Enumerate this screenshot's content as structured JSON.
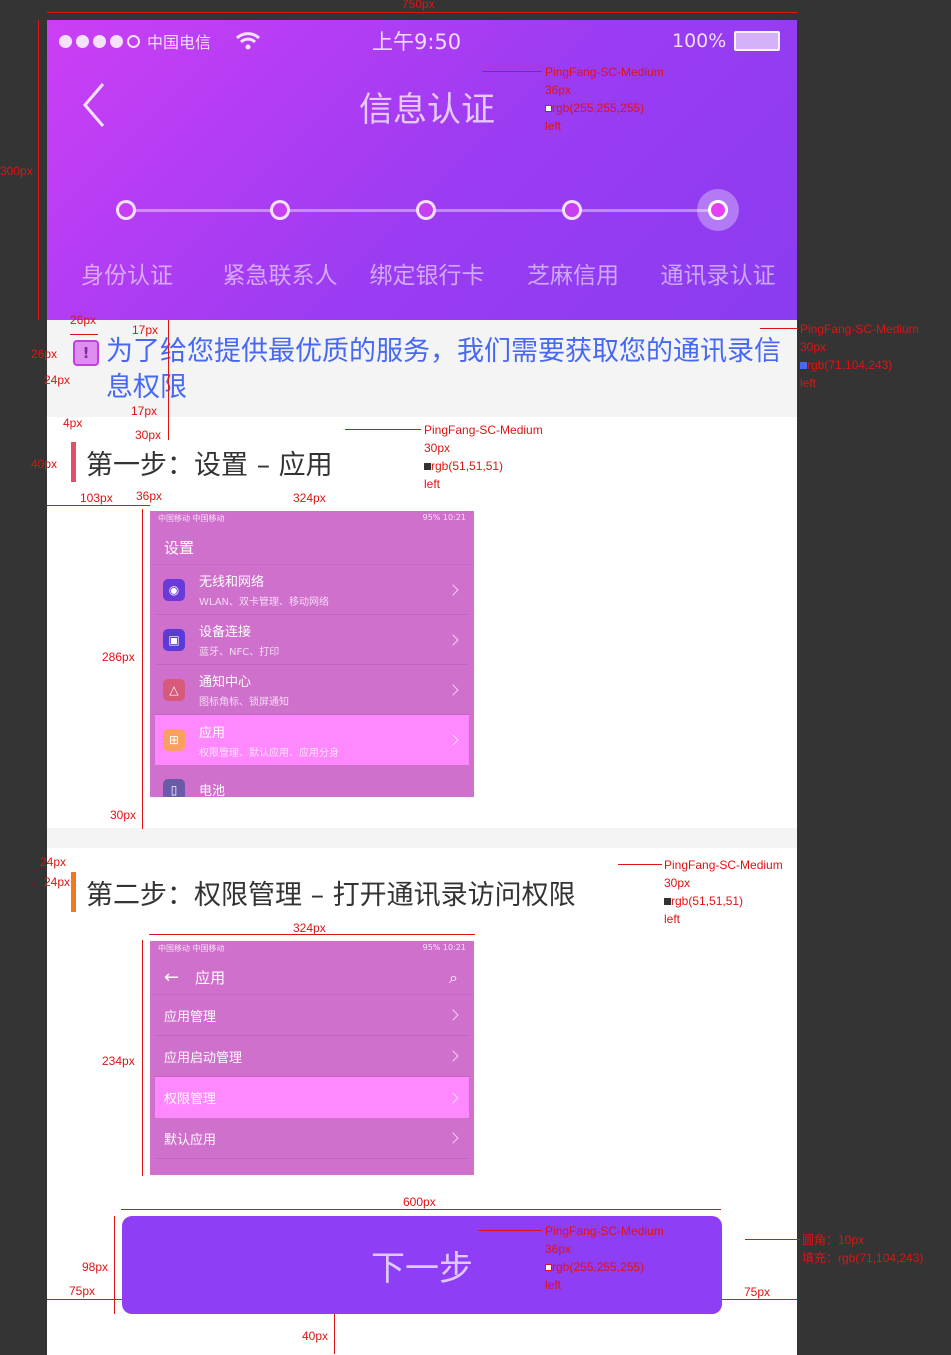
{
  "canvas_label": "750px",
  "status": {
    "carrier": "中国电信",
    "time": "上午9:50",
    "battery": "100%"
  },
  "nav": {
    "title": "信息认证"
  },
  "steps": [
    "身份认证",
    "紧急联系人",
    "绑定银行卡",
    "芝麻信用",
    "通讯录认证"
  ],
  "notice": {
    "text": "为了给您提供最优质的服务，我们需要获取您的通讯录信息权限"
  },
  "step1": {
    "title": "第一步：设置 – 应用",
    "shot": {
      "status_left": "中国移动  中国移动",
      "status_right": "95%  10:21",
      "header": "设置",
      "rows": [
        {
          "title": "无线和网络",
          "sub": "WLAN、双卡管理、移动网络"
        },
        {
          "title": "设备连接",
          "sub": "蓝牙、NFC、打印"
        },
        {
          "title": "通知中心",
          "sub": "图标角标、锁屏通知"
        },
        {
          "title": "应用",
          "sub": "权限管理、默认应用、应用分身"
        },
        {
          "title": "电池",
          "sub": ""
        }
      ]
    }
  },
  "step2": {
    "title": "第二步：权限管理 – 打开通讯录访问权限",
    "shot": {
      "status_left": "中国移动  中国移动",
      "status_right": "95%  10:21",
      "header": "应用",
      "rows": [
        "应用管理",
        "应用启动管理",
        "权限管理",
        "默认应用"
      ]
    }
  },
  "button": {
    "label": "下一步"
  },
  "annotations": {
    "h300": "300px",
    "w26": "26px",
    "h17a": "17px",
    "h26": "26px",
    "w24": "24px",
    "h17b": "17px",
    "w4": "4px",
    "h30a": "30px",
    "h40": "40px",
    "w103": "103px",
    "w36": "36px",
    "w324a": "324px",
    "h286": "286px",
    "h30b": "30px",
    "h24a": "24px",
    "h24b": "24px",
    "w324b": "324px",
    "h234": "234px",
    "w600": "600px",
    "h98": "98px",
    "w75a": "75px",
    "w75b": "75px",
    "h40b": "40px",
    "title_spec": {
      "font": "PingFang-SC-Medium",
      "size": "36px",
      "color": "rgb(255,255,255)",
      "align": "left"
    },
    "notice_spec": {
      "font": "PingFang-SC-Medium",
      "size": "30px",
      "color": "rgb(71,104,243)",
      "align": "left"
    },
    "step1_spec": {
      "font": "PingFang-SC-Medium",
      "size": "30px",
      "color": "rgb(51,51,51)",
      "align": "left"
    },
    "step2_spec": {
      "font": "PingFang-SC-Medium",
      "size": "30px",
      "color": "rgb(51,51,51)",
      "align": "left"
    },
    "btn_spec": {
      "font": "PingFang-SC-Medium",
      "size": "36px",
      "color": "rgb(255,255,255)",
      "align": "left"
    },
    "btn_style": {
      "radius": "圆角：10px",
      "fill": "填充：rgb(71,104,243)"
    }
  },
  "colors": {
    "header_start": "#cc3ef5",
    "header_end": "#8a3cf0",
    "notice_text": "#4768f3",
    "button": "#8e3ef5",
    "annotation": "#e01313",
    "step1_bar": "#e0506b",
    "step2_bar": "#f07a1e"
  }
}
